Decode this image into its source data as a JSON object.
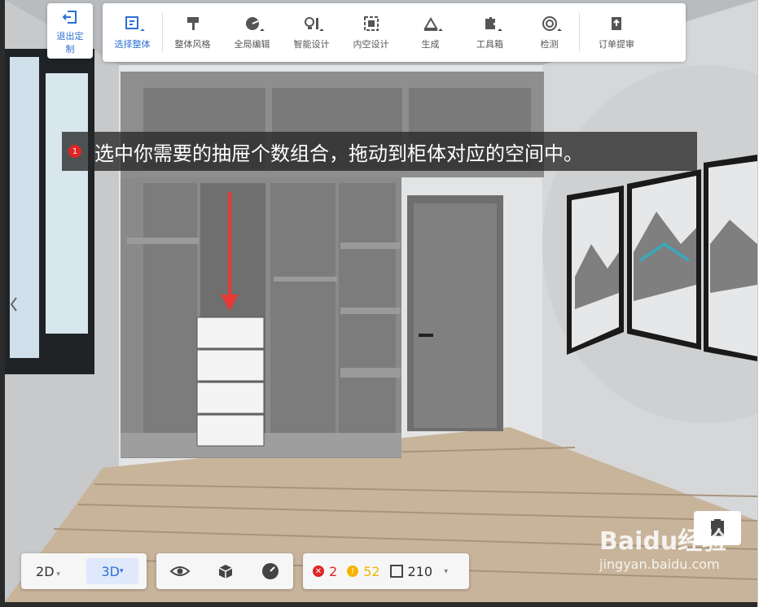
{
  "toolbar": {
    "exit_label": "退出定制",
    "items": [
      {
        "label": "选择整体",
        "icon": "select-whole-icon",
        "active": true
      },
      {
        "label": "整体风格",
        "icon": "style-brush-icon"
      },
      {
        "label": "全局编辑",
        "icon": "global-edit-icon"
      },
      {
        "label": "智能设计",
        "icon": "smart-design-icon"
      },
      {
        "label": "内空设计",
        "icon": "inner-space-icon"
      },
      {
        "label": "生成",
        "icon": "generate-icon"
      },
      {
        "label": "工具箱",
        "icon": "toolbox-icon"
      },
      {
        "label": "检测",
        "icon": "detect-icon"
      },
      {
        "label": "订单提审",
        "icon": "order-submit-icon"
      }
    ]
  },
  "instruction": {
    "step_number": "1",
    "text": "选中你需要的抽屉个数组合，拖动到柜体对应的空间中。"
  },
  "view_switch": {
    "mode_2d": "2D",
    "mode_3d": "3D"
  },
  "status": {
    "errors": "2",
    "warnings": "52",
    "parts": "210"
  },
  "watermark": {
    "brand": "Baidu经验",
    "url": "jingyan.baidu.com"
  },
  "colors": {
    "accent": "#2d6fd6",
    "error": "#e02424",
    "warning": "#f4b400",
    "arrow": "#e53935"
  }
}
